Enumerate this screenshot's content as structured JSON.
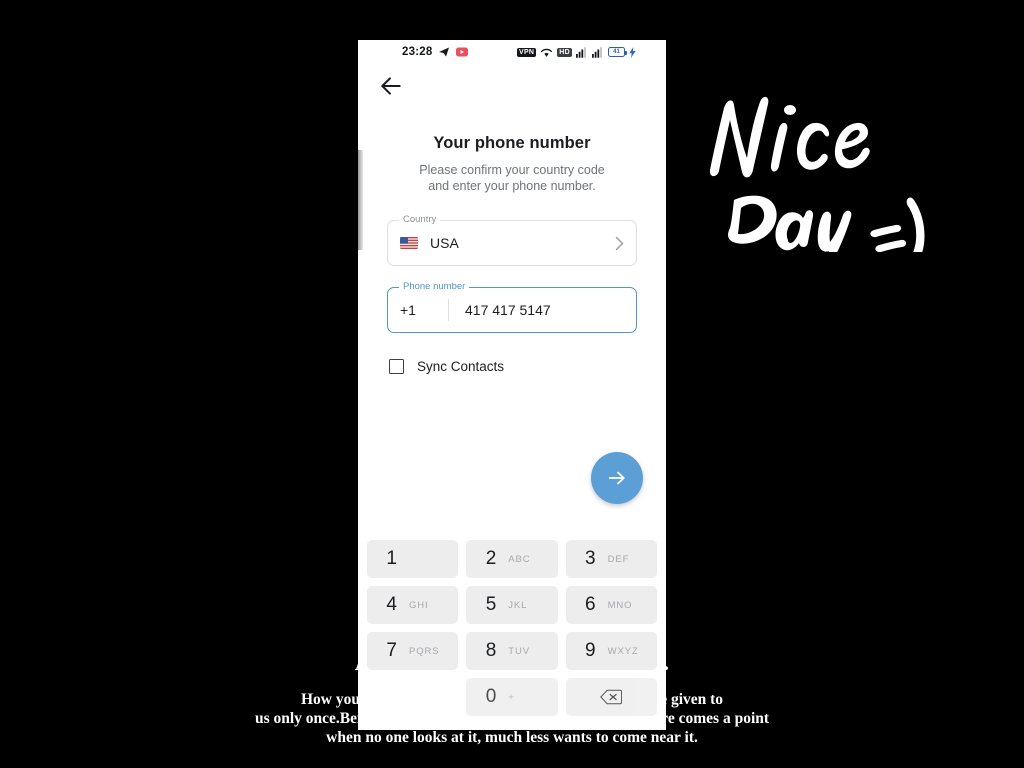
{
  "background": {
    "headline": "Amor de amado amar perdona.",
    "body_lines": [
      "How you live your life is your choice and our bodies are given to",
      "us only once.Before you know it,  he becomes as your body there comes a point",
      "when no one looks at it,  much less wants to come near it."
    ],
    "handwriting_text": "Nice Day =)"
  },
  "status_bar": {
    "clock": "23:28",
    "left_icons": [
      "telegram-icon",
      "youtube-icon"
    ],
    "vpn_label": "VPN",
    "hd_label": "HD",
    "right_icons": [
      "wifi-icon",
      "signal-icon",
      "signal-icon"
    ],
    "battery_level": "41",
    "charging": true
  },
  "app": {
    "back_icon": "back-arrow-icon",
    "title": "Your phone number",
    "subtitle_line1": "Please confirm your country code",
    "subtitle_line2": "and enter your phone number.",
    "country_field": {
      "label": "Country",
      "value": "USA",
      "flag": "usa-flag-icon",
      "chevron": "chevron-right-icon"
    },
    "phone_field": {
      "label": "Phone number",
      "dial_code": "+1",
      "value": "417 417 5147",
      "focused": true,
      "accent_color": "#4f96cf"
    },
    "sync": {
      "label": "Sync Contacts",
      "checked": false
    },
    "fab": {
      "icon": "arrow-right-icon",
      "color": "#5c9fd6"
    }
  },
  "keypad": {
    "rows": [
      [
        {
          "digit": "1",
          "letters": ""
        },
        {
          "digit": "2",
          "letters": "ABC"
        },
        {
          "digit": "3",
          "letters": "DEF"
        }
      ],
      [
        {
          "digit": "4",
          "letters": "GHI"
        },
        {
          "digit": "5",
          "letters": "JKL"
        },
        {
          "digit": "6",
          "letters": "MNO"
        }
      ],
      [
        {
          "digit": "7",
          "letters": "PQRS"
        },
        {
          "digit": "8",
          "letters": "TUV"
        },
        {
          "digit": "9",
          "letters": "WXYZ"
        }
      ],
      [
        {
          "digit": "",
          "letters": ""
        },
        {
          "digit": "0",
          "letters": "+"
        },
        {
          "digit": "backspace-icon",
          "letters": ""
        }
      ]
    ]
  }
}
